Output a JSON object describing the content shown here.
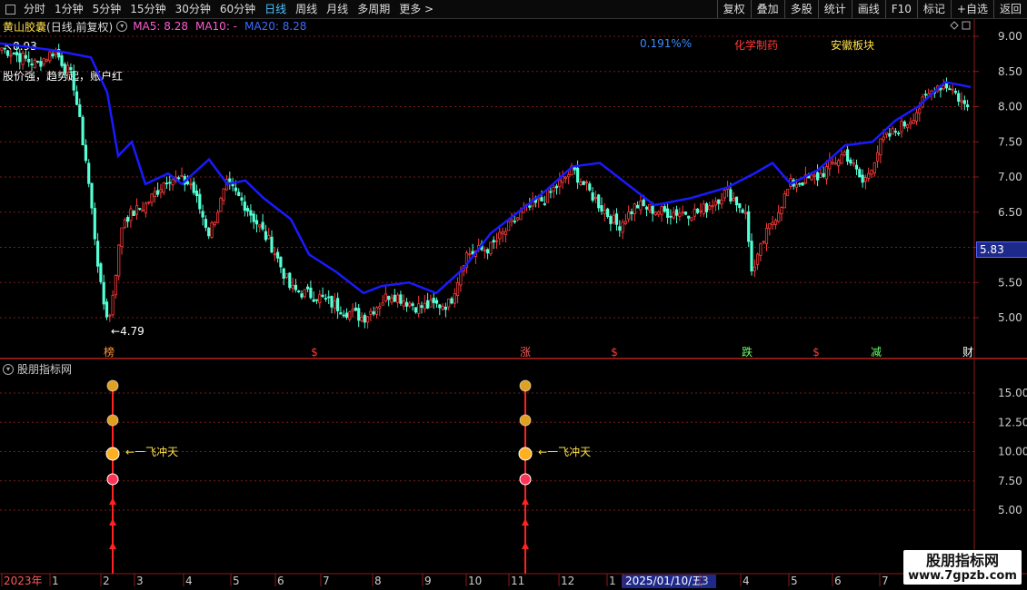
{
  "toolbar": {
    "periods": [
      "分时",
      "1分钟",
      "5分钟",
      "15分钟",
      "30分钟",
      "60分钟",
      "日线",
      "周线",
      "月线",
      "多周期",
      "更多"
    ],
    "active_index": 6,
    "more_arrow": ">",
    "right_buttons": [
      "复权",
      "叠加",
      "多股",
      "统计",
      "画线",
      "F10",
      "标记",
      "+自选",
      "返回"
    ]
  },
  "stock": {
    "name": "黄山胶囊",
    "mode": "(日线,前复权)",
    "ma5": "MA5: 8.28",
    "ma10": "MA10: -",
    "ma20": "MA20: 8.28"
  },
  "annotations": {
    "high_label": "8.93",
    "low_label": "4.79",
    "slogan": "股价强，趋势起，账户红",
    "pct": "0.191%%",
    "sector1": "化学制药",
    "sector2": "安徽板块",
    "last_price": "5.83"
  },
  "markers": [
    {
      "label": "榜",
      "color": "#ff9a3a"
    },
    {
      "label": "$",
      "color": "#ff3a3a"
    },
    {
      "label": "涨",
      "color": "#ff5a5a"
    },
    {
      "label": "$",
      "color": "#ff3a3a"
    },
    {
      "label": "跌",
      "color": "#6cff6c"
    },
    {
      "label": "$",
      "color": "#ff3a3a"
    },
    {
      "label": "减",
      "color": "#6cff6c"
    },
    {
      "label": "财",
      "color": "#ffffff"
    }
  ],
  "indicator": {
    "title": "股朋指标网",
    "signal_label": "一飞冲天"
  },
  "axes": {
    "price_ticks": [
      "9.00",
      "8.50",
      "8.00",
      "7.50",
      "7.00",
      "6.50",
      "6.00",
      "5.50",
      "5.00"
    ],
    "ind_ticks": [
      "15.00",
      "12.50",
      "10.00",
      "7.50",
      "5.00"
    ]
  },
  "timeline": {
    "labels": [
      "2023年",
      "1",
      "2",
      "3",
      "4",
      "5",
      "6",
      "7",
      "8",
      "9",
      "10",
      "11",
      "12",
      "1",
      "2025/01/10/五",
      "3",
      "4",
      "5",
      "6",
      "7"
    ]
  },
  "watermark": {
    "line1": "股朋指标网",
    "line2": "www.7gpzb.com"
  },
  "colors": {
    "up": "#ff3b3b",
    "down": "#54ffd6",
    "ma": "#1a1aff",
    "grid": "#7a1a1a"
  }
}
